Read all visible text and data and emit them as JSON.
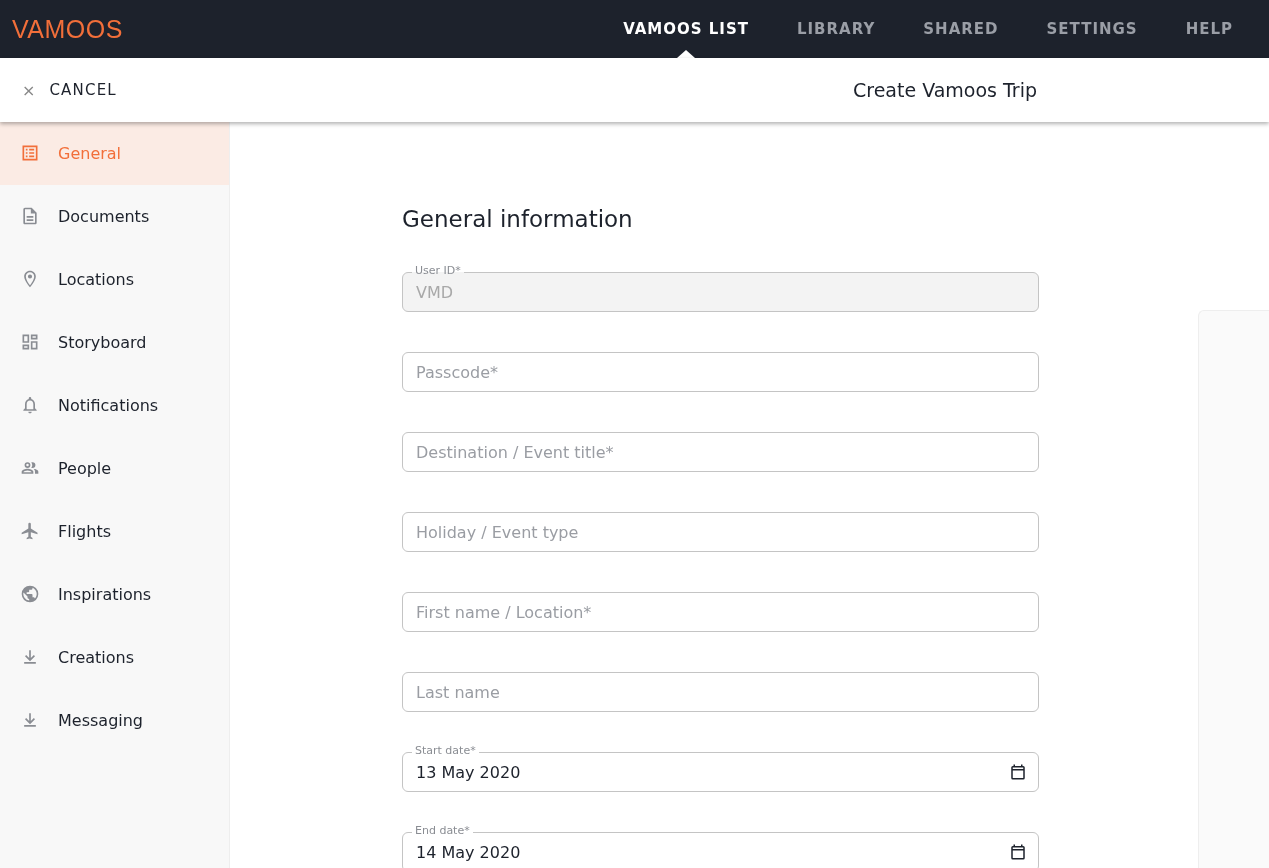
{
  "brand": {
    "logo": "VAMOOS"
  },
  "nav": [
    {
      "label": "VAMOOS LIST",
      "selected": true
    },
    {
      "label": "LIBRARY",
      "selected": false
    },
    {
      "label": "SHARED",
      "selected": false
    },
    {
      "label": "SETTINGS",
      "selected": false
    },
    {
      "label": "HELP",
      "selected": false
    }
  ],
  "toolbar": {
    "cancel_icon": "×",
    "cancel": "CANCEL",
    "title": "Create Vamoos Trip"
  },
  "sidebar": {
    "items": [
      {
        "label": "General",
        "selected": true
      },
      {
        "label": "Documents",
        "selected": false
      },
      {
        "label": "Locations",
        "selected": false
      },
      {
        "label": "Storyboard",
        "selected": false
      },
      {
        "label": "Notifications",
        "selected": false
      },
      {
        "label": "People",
        "selected": false
      },
      {
        "label": "Flights",
        "selected": false
      },
      {
        "label": "Inspirations",
        "selected": false
      },
      {
        "label": "Creations",
        "selected": false
      },
      {
        "label": "Messaging",
        "selected": false
      }
    ]
  },
  "form": {
    "heading": "General information",
    "fields": [
      {
        "kind": "text",
        "label": "User ID*",
        "value": "VMD",
        "disabled": true
      },
      {
        "kind": "text",
        "placeholder": "Passcode*",
        "disabled": false
      },
      {
        "kind": "text",
        "placeholder": "Destination / Event title*",
        "disabled": false
      },
      {
        "kind": "text",
        "placeholder": "Holiday / Event type",
        "disabled": false
      },
      {
        "kind": "text",
        "placeholder": "First name / Location*",
        "disabled": false
      },
      {
        "kind": "text",
        "placeholder": "Last name",
        "disabled": false
      },
      {
        "kind": "date",
        "label": "Start date*",
        "value": "13 May 2020",
        "disabled": false
      },
      {
        "kind": "date",
        "label": "End date*",
        "value": "14 May 2020",
        "disabled": false
      }
    ]
  }
}
